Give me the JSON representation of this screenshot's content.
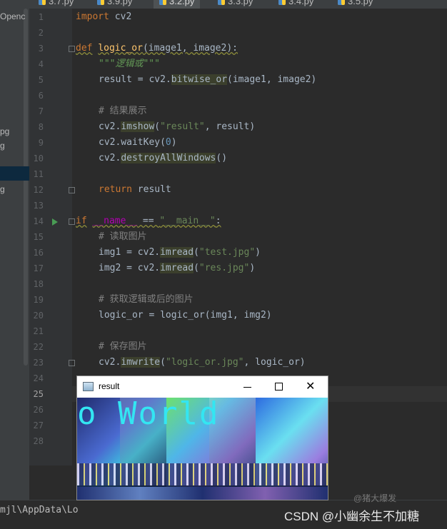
{
  "tabs": [
    {
      "label": "3.7.py",
      "active": false
    },
    {
      "label": "3.9.py",
      "active": false
    },
    {
      "label": "3.2.py",
      "active": true
    },
    {
      "label": "3.3.py",
      "active": false
    },
    {
      "label": "3.4.py",
      "active": false
    },
    {
      "label": "3.5.py",
      "active": false
    }
  ],
  "project": {
    "items": [
      "Openc",
      "pg",
      "g",
      "g"
    ]
  },
  "editor": {
    "line_numbers": [
      "1",
      "2",
      "3",
      "4",
      "5",
      "6",
      "7",
      "8",
      "9",
      "10",
      "11",
      "12",
      "13",
      "14",
      "15",
      "16",
      "17",
      "18",
      "19",
      "20",
      "21",
      "22",
      "23",
      "24",
      "25",
      "26",
      "27",
      "28"
    ],
    "code": {
      "l1_import": "import",
      "l1_mod": " cv2",
      "l3_def": "def",
      "l3_name": "logic_or",
      "l3_args": "(image1, image2):",
      "l4_doc": "\"\"\"逻辑或\"\"\"",
      "l5_a": "result = cv2.",
      "l5_fn": "bitwise_or",
      "l5_b": "(image1, image2)",
      "l7_cmt": "# 结果展示",
      "l8_a": "cv2.",
      "l8_fn": "imshow",
      "l8_b": "(",
      "l8_str": "\"result\"",
      "l8_c": ", result)",
      "l9_a": "cv2.waitKey(",
      "l9_num": "0",
      "l9_b": ")",
      "l10_a": "cv2.",
      "l10_fn": "destroyAllWindows",
      "l10_b": "()",
      "l12_ret": "return",
      "l12_val": " result",
      "l14_if": "if",
      "l14_name": "__name__",
      "l14_eq": " == ",
      "l14_str": "\"__main__\"",
      "l14_colon": ":",
      "l15_cmt": "# 读取图片",
      "l16_a": "img1 = cv2.",
      "l16_fn": "imread",
      "l16_b": "(",
      "l16_str": "\"test.jpg\"",
      "l16_c": ")",
      "l17_a": "img2 = cv2.",
      "l17_fn": "imread",
      "l17_b": "(",
      "l17_str": "\"res.jpg\"",
      "l17_c": ")",
      "l19_cmt": "# 获取逻辑或后的图片",
      "l20_a": "logic_or = logic_or(img1, img2)",
      "l22_cmt": "# 保存图片",
      "l23_a": "cv2.",
      "l23_fn": "imwrite",
      "l23_b": "(",
      "l23_str": "\"logic_or.jpg\"",
      "l23_c": ", logic_or)"
    }
  },
  "result_window": {
    "title": "result",
    "minimize": "–",
    "maximize": "□",
    "close": "✕",
    "image_text": "o World"
  },
  "terminal": {
    "path": "mjl\\AppData\\Lo"
  },
  "watermark": {
    "text": "CSDN @小幽余生不加糖",
    "ghost": "@猪大爆发"
  },
  "colors": {
    "editor_bg": "#2b2b2b",
    "keyword": "#cc7832",
    "function": "#ffc66d",
    "string": "#6a8759",
    "comment": "#808080",
    "number": "#6897bb"
  }
}
